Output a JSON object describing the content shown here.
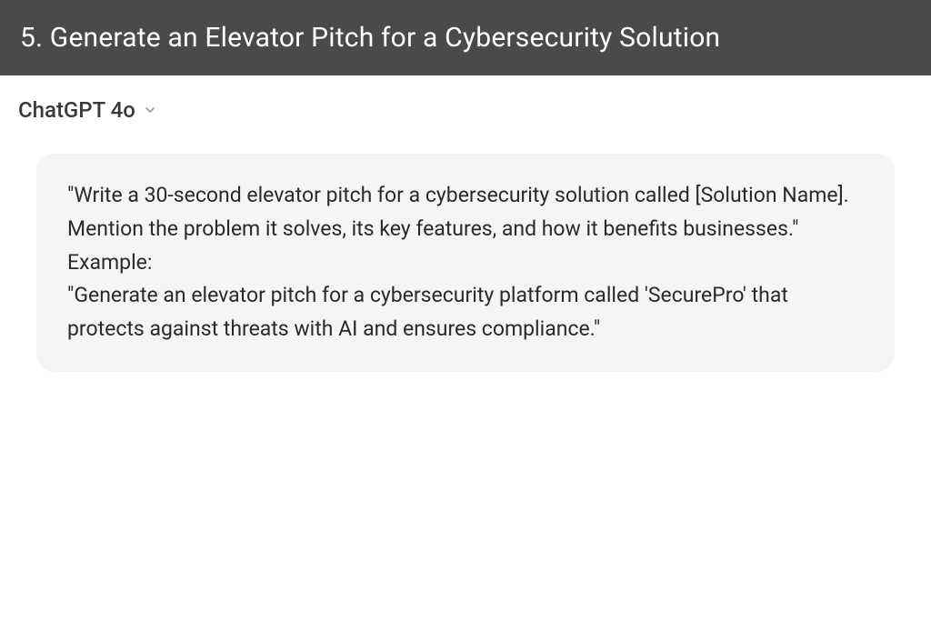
{
  "header": {
    "title": "5. Generate an Elevator Pitch for a Cybersecurity Solution"
  },
  "model_selector": {
    "name": "ChatGPT 4o"
  },
  "message": {
    "line1": "\"Write a 30-second elevator pitch for a cybersecurity solution called [Solution Name]. Mention the problem it solves, its key features, and how it benefits businesses.\"",
    "line2": "Example:",
    "line3": "\"Generate an elevator pitch for a cybersecurity platform called 'SecurePro' that protects against threats with AI and ensures compliance.\""
  }
}
